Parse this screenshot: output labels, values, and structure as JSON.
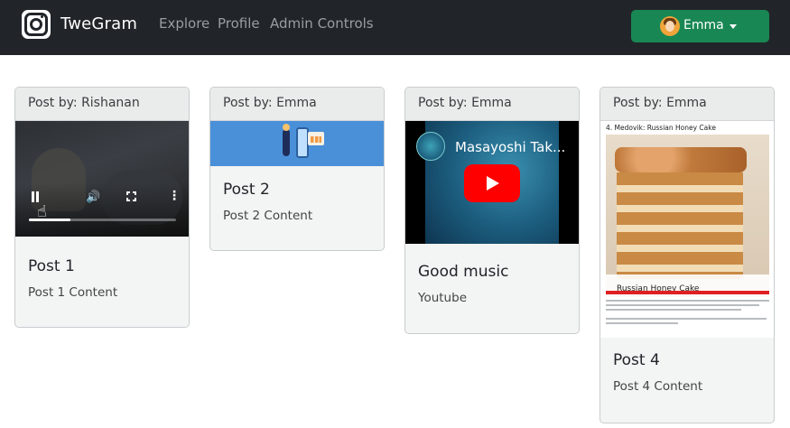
{
  "navbar": {
    "brand": "TweGram",
    "links": [
      "Explore",
      "Profile",
      "Admin Controls"
    ],
    "user": "Emma",
    "user_button_color": "#198754",
    "background": "#212529"
  },
  "icons": {
    "brand": "instagram-logo-icon",
    "avatar": "user-avatar-icon",
    "dropdown": "caret-down-icon"
  },
  "posts": [
    {
      "author_label": "Post by: Rishanan",
      "media": "video",
      "video_progress": 0.28,
      "title": "Post 1",
      "content": "Post 1 Content"
    },
    {
      "author_label": "Post by: Emma",
      "media": "image",
      "title": "Post 2",
      "content": "Post 2 Content"
    },
    {
      "author_label": "Post by: Emma",
      "media": "youtube",
      "video_title": "Masayoshi Tak...",
      "title": "Good music",
      "content": "Youtube"
    },
    {
      "author_label": "Post by: Emma",
      "media": "article",
      "article_heading": "4. Medovik: Russian Honey Cake",
      "image_caption": "Russian Honey Cake",
      "title": "Post 4",
      "content": "Post 4 Content"
    }
  ]
}
